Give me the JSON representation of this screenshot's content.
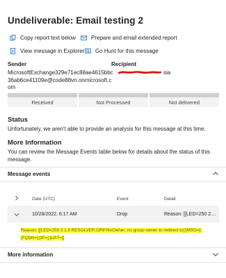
{
  "title": "Undeliverable: Email testing 2",
  "actions": {
    "copy_report": "Copy report text below",
    "prepare_email": "Prepare and email extended report",
    "view_message": "View message in Explorer",
    "go_hunt": "Go Hunt for this message"
  },
  "sender": {
    "label": "Sender",
    "value_line1": "MicrosoftExchange329e71ec88ae4615bbc",
    "value_line2": "36ab6ce41109e@code88vn.onmicrosoft.c",
    "value_line3": "om"
  },
  "recipient": {
    "label": "Recipient",
    "value_suffix": "sia"
  },
  "progress_steps": [
    "Received",
    "Not Processed",
    "Not delivered"
  ],
  "status": {
    "heading": "Status",
    "text": "Unfortunately, we aren't able to provide an analysis for this message at this time."
  },
  "more_info": {
    "heading": "More Information",
    "text": "You can review the Message Events table below for details about the status of this message."
  },
  "message_events": {
    "heading": "Message events",
    "columns": {
      "date": "Date (UTC)",
      "event": "Event",
      "detail": "Detail"
    },
    "row": {
      "date": "10/28/2022, 6:17 AM",
      "event": "Drop",
      "detail": "Reason: [[LED=250 2...."
    },
    "reason_line1": "Reason: [[LED=250 2.1.5 RESOLVER.GRP.NoOwner; no group owner to redirect to];[MSG=];",
    "reason_line2": "[FQDN=];[IP=];[LRT=]]"
  },
  "more_information_panel": {
    "heading": "More information"
  },
  "colors": {
    "icon_blue": "#0f6cbd",
    "highlight": "#ffff32",
    "redaction": "#e01010"
  },
  "icons": [
    "copy-icon",
    "mail-icon",
    "document-icon",
    "hunt-icon",
    "chevron-up-icon",
    "chevron-right-icon",
    "chevron-down-icon"
  ]
}
